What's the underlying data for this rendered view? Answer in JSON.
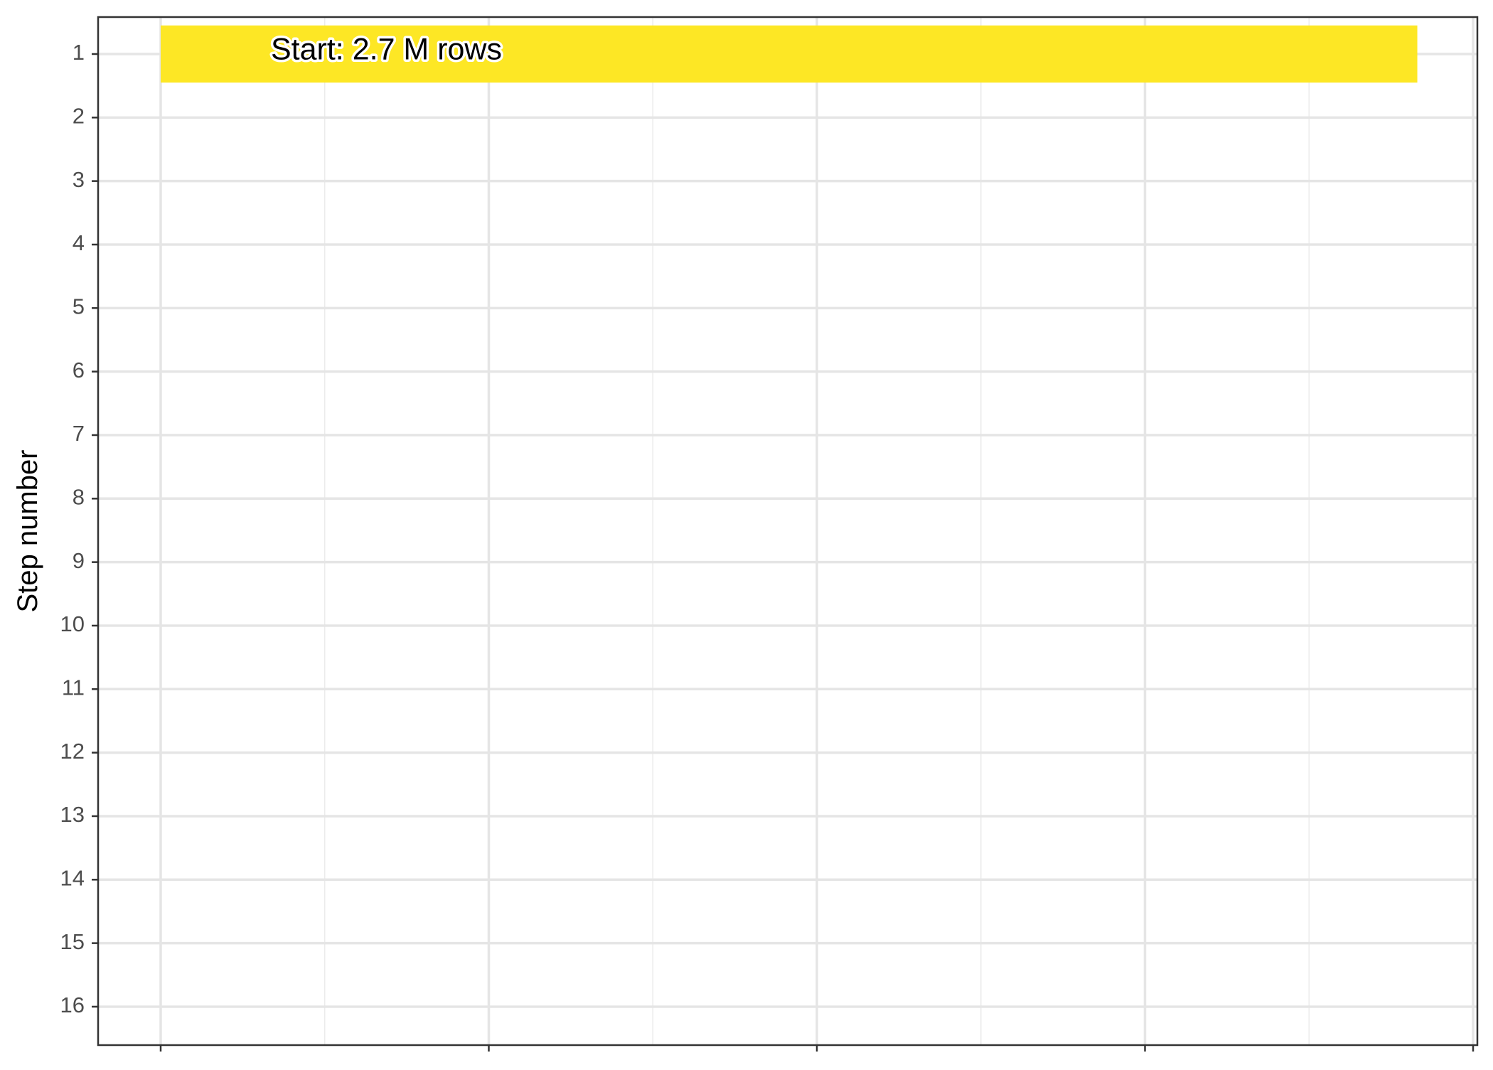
{
  "chart_data": {
    "type": "bar",
    "orientation": "horizontal",
    "title": "",
    "xlabel": "",
    "ylabel": "Step number",
    "y_ticks": [
      "1",
      "2",
      "3",
      "4",
      "5",
      "6",
      "7",
      "8",
      "9",
      "10",
      "11",
      "12",
      "13",
      "14",
      "15",
      "16"
    ],
    "x_ticks": [
      "",
      "",
      "",
      "",
      ""
    ],
    "xlim": [
      0,
      4
    ],
    "bars": [
      {
        "step": 1,
        "start": 0,
        "end": 3.83,
        "label": "Start:  2.7 M rows"
      }
    ],
    "bar_color": "#FDE725",
    "grid": true,
    "legend": "none"
  }
}
